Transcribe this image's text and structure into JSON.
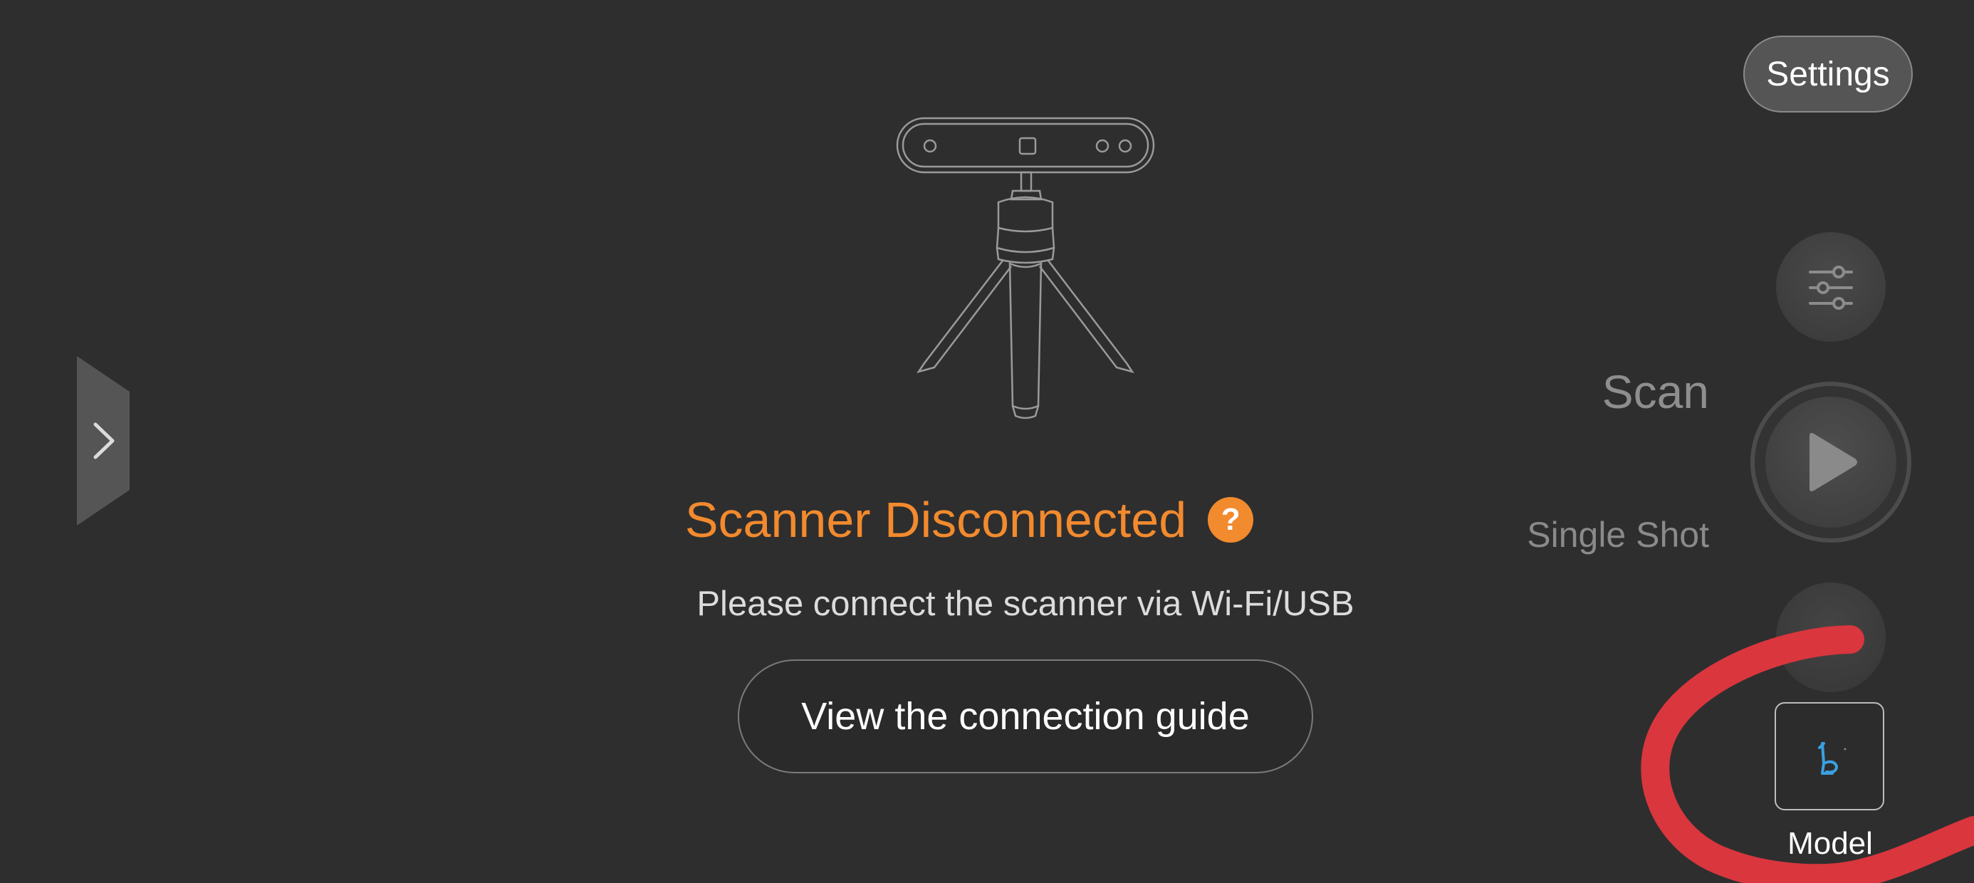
{
  "header": {
    "settings_label": "Settings"
  },
  "status": {
    "title": "Scanner Disconnected",
    "help_icon": "question-icon",
    "subtitle": "Please connect the scanner via Wi-Fi/USB",
    "guide_button_label": "View the connection guide"
  },
  "controls": {
    "filter_icon": "sliders-icon",
    "scan_label": "Scan",
    "single_shot_label": "Single Shot",
    "scan_icon": "play-icon",
    "edit_icon": "pencil-icon",
    "model_icon": "model-thumbnail-icon",
    "model_label": "Model"
  },
  "side": {
    "expand_icon": "chevron-right-icon"
  },
  "colors": {
    "background": "#2e2e2e",
    "accent_orange": "#f28a2e",
    "annotation_red": "#d9363e"
  }
}
